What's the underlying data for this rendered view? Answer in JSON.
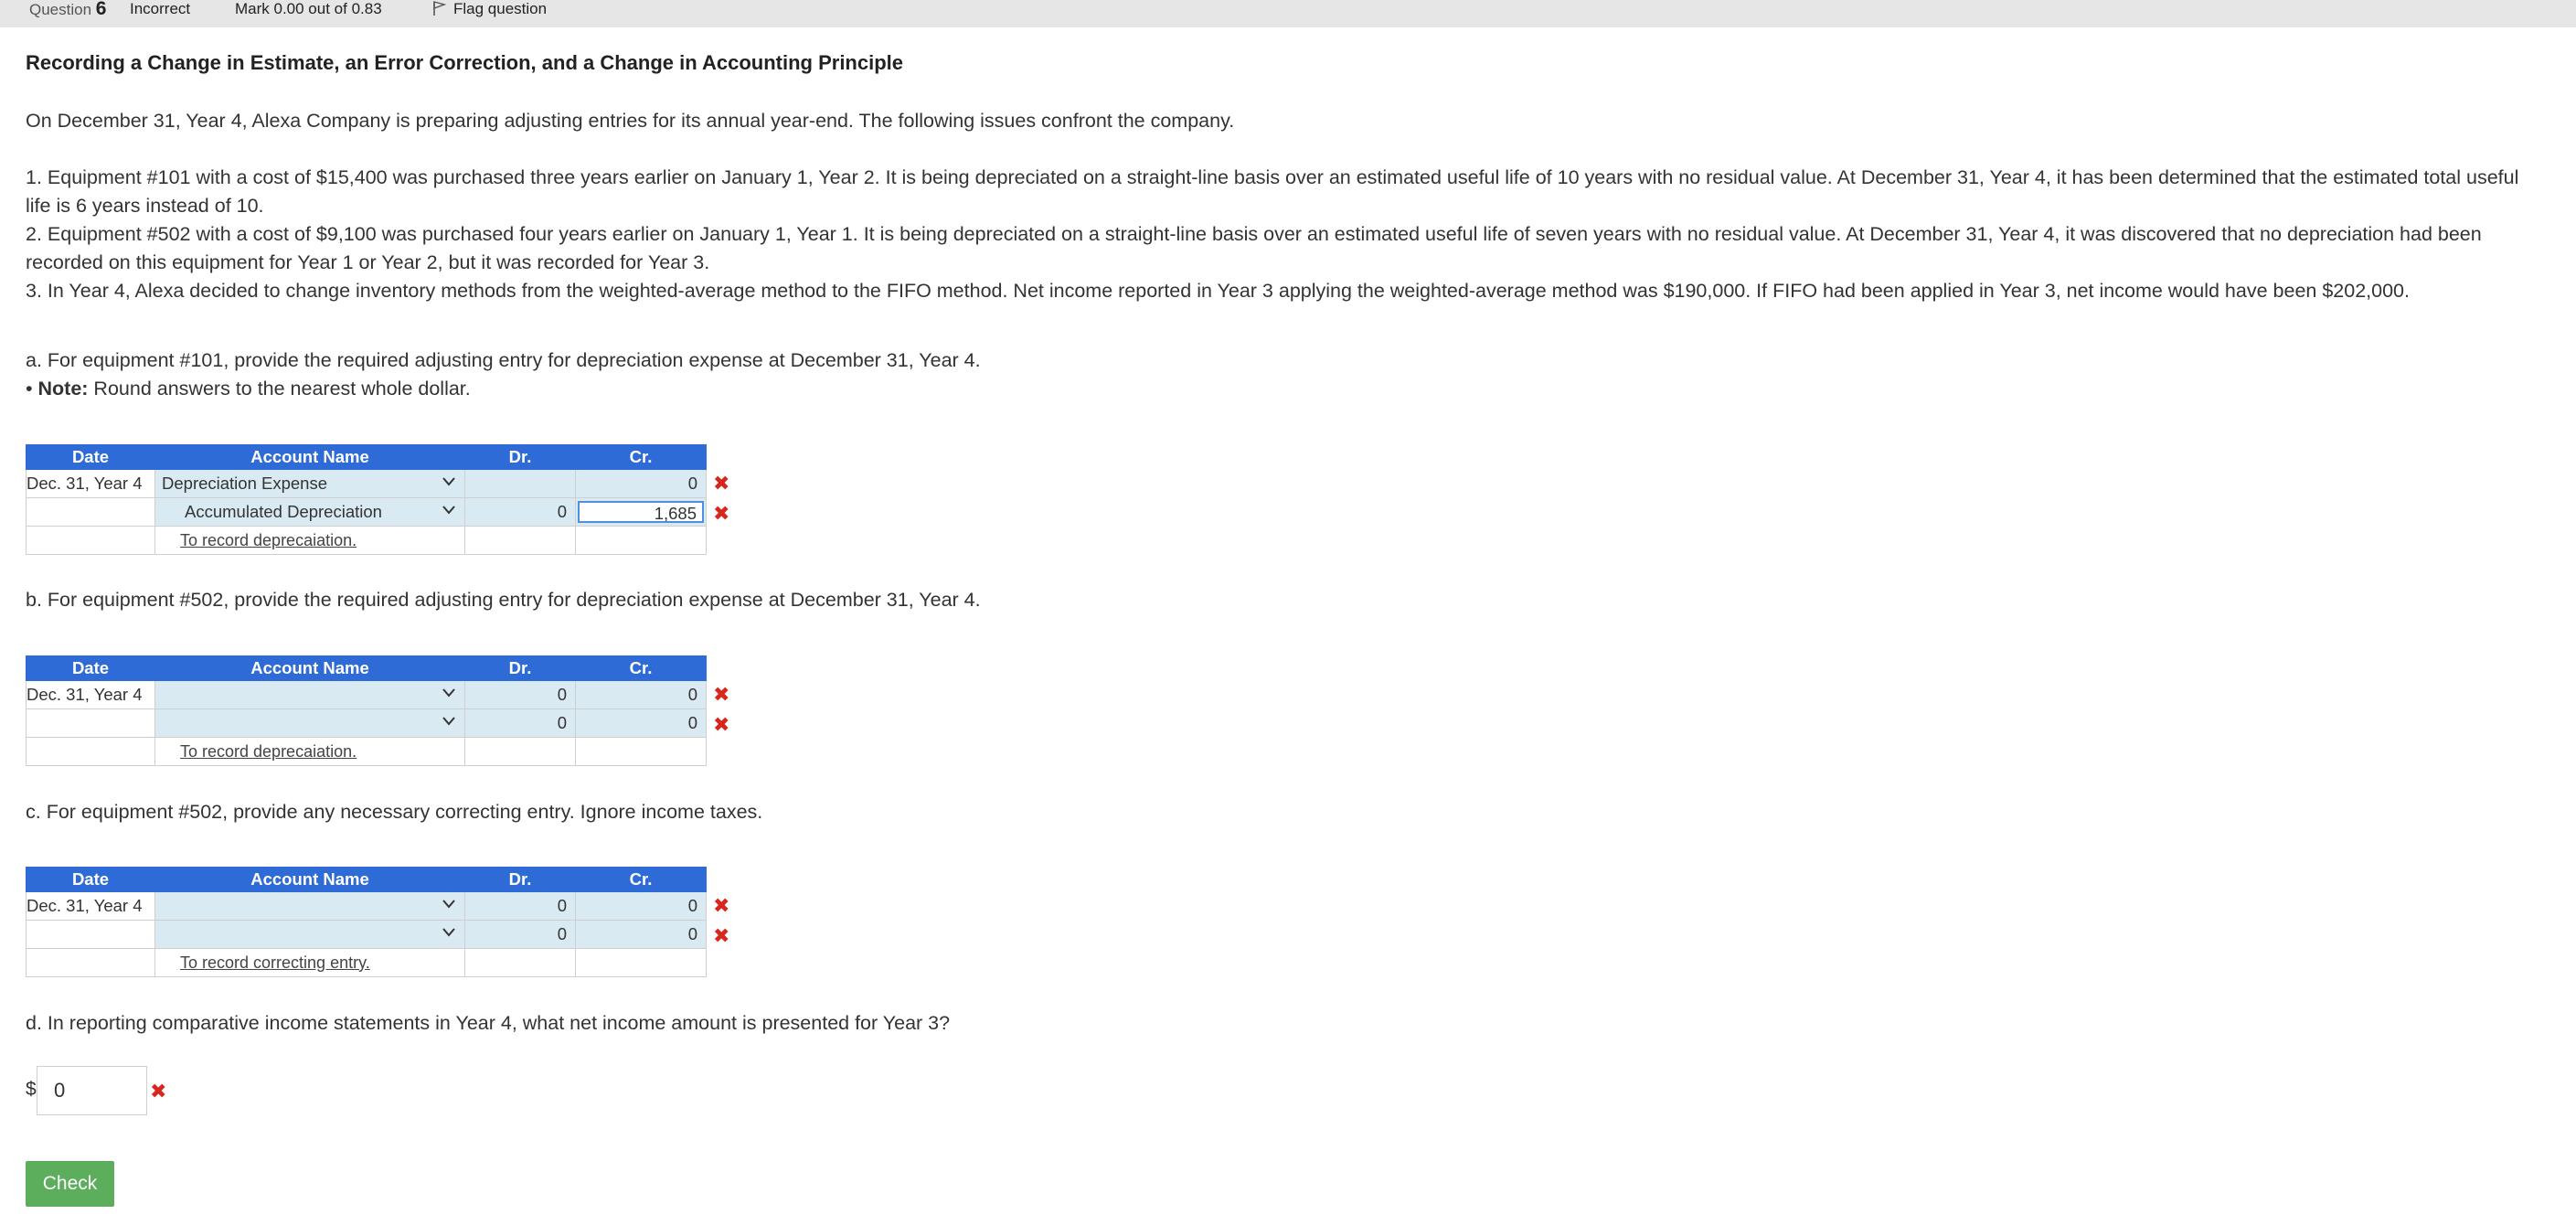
{
  "header": {
    "question_label": "Question",
    "question_number": "6",
    "status": "Incorrect",
    "mark": "Mark 0.00 out of 0.83",
    "flag": "Flag question"
  },
  "question": {
    "title": "Recording a Change in Estimate, an Error Correction, and a Change in Accounting Principle",
    "intro": "On December 31, Year 4, Alexa Company is preparing adjusting entries for its annual year-end. The following issues confront the company.",
    "item1a": "1. Equipment #101 with a cost of $15,400 was purchased three years earlier on January 1, Year 2. It is being depreciated on a straight-line basis over an estimated useful life of 10 years with no residual value. At December 31, Year 4, it has been determined that the estimated total useful",
    "item1b": "life is 6 years instead of 10.",
    "item2a": "2. Equipment #502 with a cost of $9,100 was purchased four years earlier on January 1, Year 1. It is being depreciated on a straight-line basis over an estimated useful life of seven years with no residual value. At December 31, Year 4, it was discovered that no depreciation had been",
    "item2b": "recorded on this equipment for Year 1 or Year 2, but it was recorded for Year 3.",
    "item3": "3. In Year 4, Alexa decided to change inventory methods from the weighted-average method to the FIFO method. Net income reported in Year 3 applying the weighted-average method was $190,000. If FIFO had been applied in Year 3, net income would have been $202,000.",
    "part_a": "a. For equipment #101, provide the required adjusting entry for depreciation expense at December 31, Year 4.",
    "note_label": "Note:",
    "note_text": " Round answers to the nearest whole dollar.",
    "part_b": "b. For equipment #502, provide the required adjusting entry for depreciation expense at December 31, Year 4.",
    "part_c": "c. For equipment #502, provide any necessary correcting entry. Ignore income taxes.",
    "part_d": "d. In reporting comparative income statements in Year 4, what net income amount is presented for Year 3?"
  },
  "table_headers": {
    "date": "Date",
    "account": "Account Name",
    "dr": "Dr.",
    "cr": "Cr."
  },
  "entry_a": {
    "date": "Dec. 31, Year 4",
    "row1": {
      "account": "Depreciation Expense",
      "dr": "",
      "cr": "0"
    },
    "row2": {
      "account": "Accumulated Depreciation",
      "dr": "0",
      "cr": "1,685"
    },
    "memo": "To record deprecaiation."
  },
  "entry_b": {
    "date": "Dec. 31, Year 4",
    "row1": {
      "account": "",
      "dr": "0",
      "cr": "0"
    },
    "row2": {
      "account": "",
      "dr": "0",
      "cr": "0"
    },
    "memo": "To record deprecaiation."
  },
  "entry_c": {
    "date": "Dec. 31, Year 4",
    "row1": {
      "account": "",
      "dr": "0",
      "cr": "0"
    },
    "row2": {
      "account": "",
      "dr": "0",
      "cr": "0"
    },
    "memo": "To record correcting entry."
  },
  "answer_d": {
    "currency": "$",
    "value": "0"
  },
  "check_label": "Check",
  "incorrect_mark": "✖",
  "colors": {
    "header_blue": "#2f6bd6",
    "cell_fill": "#daeaf2",
    "error_red": "#d9261c",
    "check_green": "#5cad5c"
  }
}
